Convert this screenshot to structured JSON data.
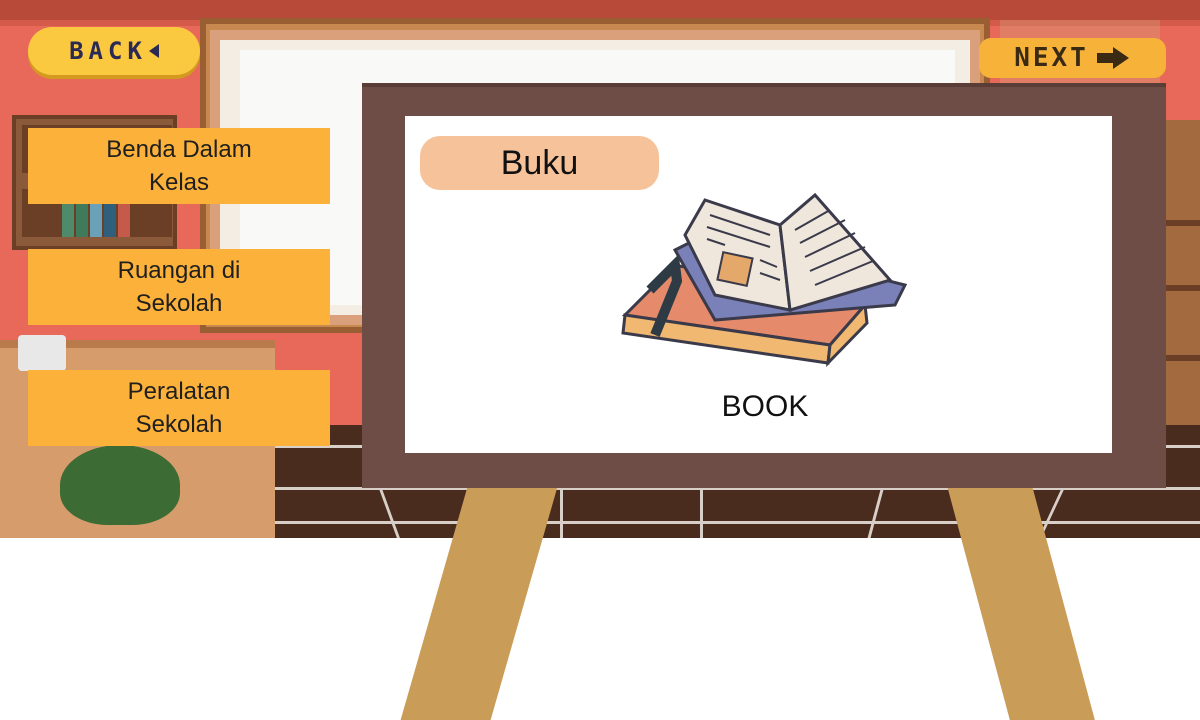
{
  "nav": {
    "back_label": "BACK",
    "next_label": "NEXT"
  },
  "menu": {
    "items": [
      {
        "label": "Benda Dalam\nKelas"
      },
      {
        "label": "Ruangan di\nSekolah"
      },
      {
        "label": "Peralatan\nSekolah"
      }
    ]
  },
  "card": {
    "title": "Buku",
    "caption": "BOOK",
    "icon": "open-book-icon"
  },
  "colors": {
    "button_yellow": "#fbc940",
    "menu_orange": "#fbb13a",
    "easel_frame": "#6d4d45",
    "easel_legs": "#c99c57",
    "tag_peach": "#f6c29a"
  }
}
